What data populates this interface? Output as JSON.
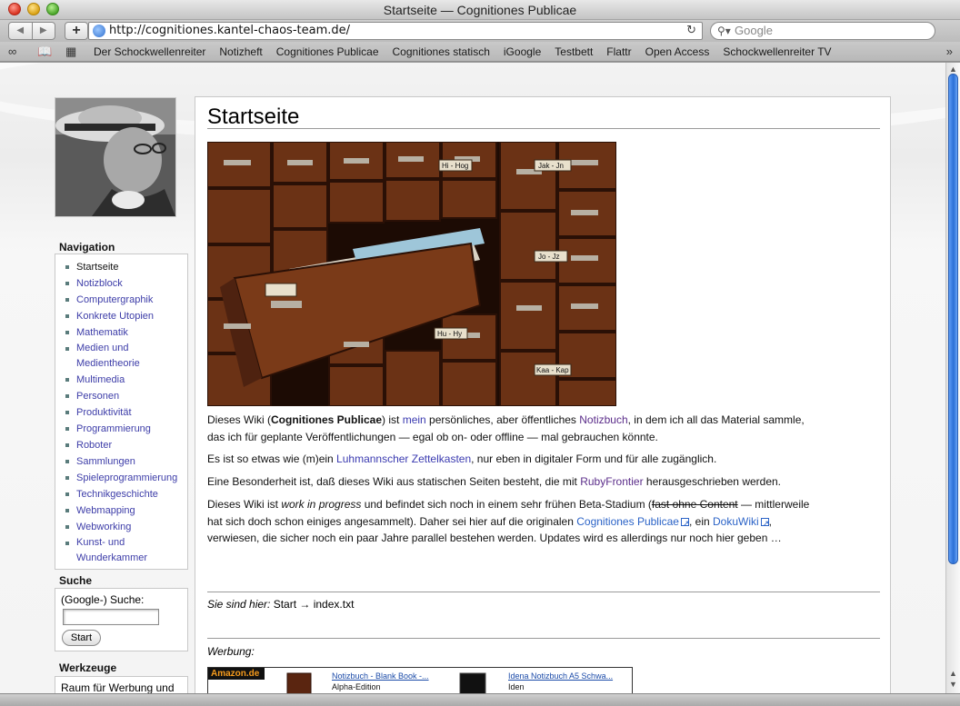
{
  "window": {
    "title": "Startseite — Cognitiones Publicae"
  },
  "toolbar": {
    "back_icon": "◀",
    "forward_icon": "▶",
    "add_icon": "+",
    "url": "http://cognitiones.kantel-chaos-team.de/",
    "reload_icon": "↻",
    "search_placeholder": "Google"
  },
  "bookmarks": {
    "items": [
      "Der Schockwellenreiter",
      "Notizheft",
      "Cognitiones Publicae",
      "Cognitiones statisch",
      "iGoogle",
      "Testbett",
      "Flattr",
      "Open Access",
      "Schockwellenreiter TV"
    ]
  },
  "sidebar": {
    "nav_title": "Navigation",
    "nav_items": [
      {
        "label": "Startseite",
        "current": true
      },
      {
        "label": "Notizblock"
      },
      {
        "label": "Computergraphik"
      },
      {
        "label": "Konkrete Utopien"
      },
      {
        "label": "Mathematik"
      },
      {
        "label": "Medien und Medientheorie"
      },
      {
        "label": "Multimedia"
      },
      {
        "label": "Personen"
      },
      {
        "label": "Produktivität"
      },
      {
        "label": "Programmierung"
      },
      {
        "label": "Roboter"
      },
      {
        "label": "Sammlungen"
      },
      {
        "label": "Spieleprogrammierung"
      },
      {
        "label": "Technikgeschichte"
      },
      {
        "label": "Webmapping"
      },
      {
        "label": "Webworking"
      },
      {
        "label": "Kunst- und Wunderkammer"
      }
    ],
    "search_title": "Suche",
    "search_label": "(Google-) Suche:",
    "search_button": "Start",
    "tools_title": "Werkzeuge",
    "tools_text": "Raum für Werbung und"
  },
  "content": {
    "title": "Startseite",
    "p1": {
      "a": "Dieses Wiki (",
      "b": "Cognitiones Publicae",
      "c": ") ist ",
      "link_mein": "mein",
      "d": " persönliches, aber öffentliches ",
      "link_notizbuch": "Notizbuch",
      "e": ", in dem ich all das Material sammle,",
      "line2": "das ich für geplante Veröffentlichungen — egal ob on- oder offline — mal gebrauchen könnte."
    },
    "p2": {
      "a": "Es ist so etwas wie (m)ein ",
      "link": "Luhmannscher Zettelkasten",
      "b": ", nur eben in digitaler Form und für alle zugänglich."
    },
    "p3": {
      "a": "Eine Besonderheit ist, daß dieses Wiki aus statischen Seiten besteht, die mit ",
      "link": "RubyFrontier",
      "b": " herausgeschrieben werden."
    },
    "p4": {
      "a": "Dieses Wiki ist ",
      "em": "work in progress",
      "b": " und befindet sich noch in einem sehr frühen Beta-Stadium (",
      "strike": "fast ohne Content",
      "c": " — mittlerweile",
      "line2a": "hat sich doch schon einiges angesammelt). Daher sei hier auf die originalen ",
      "link1": "Cognitiones Publicae",
      "line2b": ", ein ",
      "link2": "DokuWiki",
      "line2c": ",",
      "line3": "verwiesen, die sicher noch ein paar Jahre parallel bestehen werden. Updates wird es allerdings nur noch hier geben …"
    },
    "breadcrumb": {
      "label": "Sie sind hier:",
      "path": " Start → index.txt"
    },
    "ad_label": "Werbung:",
    "ads": {
      "brand": "Amazon.de",
      "item1_title": "Notizbuch - Blank Book -...",
      "item1_sub": "Alpha-Edition",
      "item2_title": "Idena Notizbuch A5 Schwa...",
      "item2_sub": "Iden"
    },
    "drawer_labels": [
      "Hi - Hog",
      "Jak - Jn",
      "Jo - Jz",
      "Hu - Hy",
      "Kaa - Kap"
    ]
  },
  "colors": {
    "link": "#3a3ab0",
    "visited_link": "#5b2d8a",
    "external_link": "#2b63c7",
    "scroll_thumb": "#2a6fd6",
    "cabinet_wood": "#5a2a12"
  }
}
